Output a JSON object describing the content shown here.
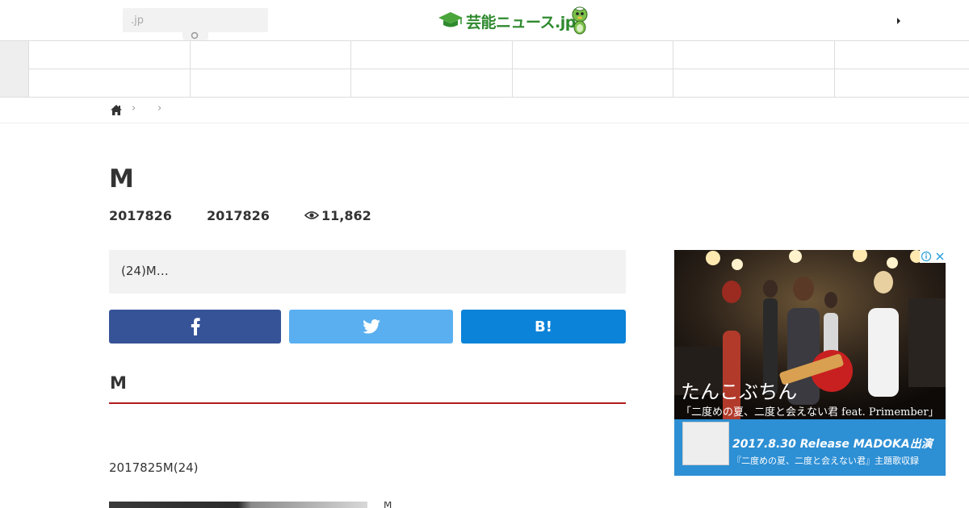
{
  "header": {
    "search_placeholder": ".jp",
    "logo_text": "芸能ニュース.jp"
  },
  "breadcrumb": {
    "separators": [
      "›",
      "›"
    ]
  },
  "article": {
    "title": "M",
    "published_date": "2017826",
    "updated_date": "2017826",
    "views": "11,862",
    "excerpt": "(24)M…",
    "section_heading": "M",
    "body_text": "2017825M(24)",
    "thumb_caption": "M"
  },
  "share": {
    "hatena_label": "B!"
  },
  "ad": {
    "artist": "たんこぶちん",
    "song": "「二度めの夏、二度と会えない君 feat. Primember」",
    "release": "2017.8.30 Release MADOKA出演",
    "album": "『二度めの夏、二度と会えない君』主題歌収録"
  },
  "colors": {
    "facebook": "#365397",
    "twitter": "#5aaff0",
    "hatena": "#0b83d9",
    "heading_rule": "#b01c1c",
    "logo_green": "#2f8a2f"
  }
}
